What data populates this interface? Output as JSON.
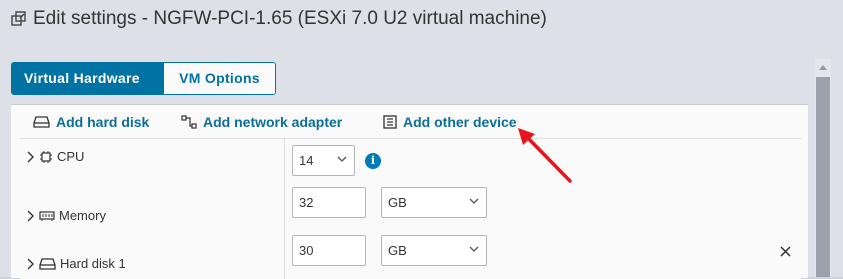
{
  "window": {
    "title": "Edit settings - NGFW-PCI-1.65 (ESXi 7.0 U2 virtual machine)",
    "title_icon": "edit-vm-icon"
  },
  "tabs": [
    {
      "label": "Virtual Hardware",
      "active": true
    },
    {
      "label": "VM Options",
      "active": false
    }
  ],
  "actions": {
    "add_hard_disk": "Add hard disk",
    "add_network_adapter": "Add network adapter",
    "add_other_device": "Add other device"
  },
  "rows": {
    "cpu": {
      "label": "CPU",
      "value": "14",
      "icon": "cpu-icon"
    },
    "memory": {
      "label": "Memory",
      "value": "32",
      "unit": "GB",
      "icon": "memory-icon"
    },
    "hard_disk": {
      "label": "Hard disk 1",
      "value": "30",
      "unit": "GB",
      "icon": "hard-disk-icon"
    }
  },
  "colors": {
    "accent": "#0072a3",
    "link": "#0b6e99",
    "annotation_arrow": "#e8141b"
  }
}
